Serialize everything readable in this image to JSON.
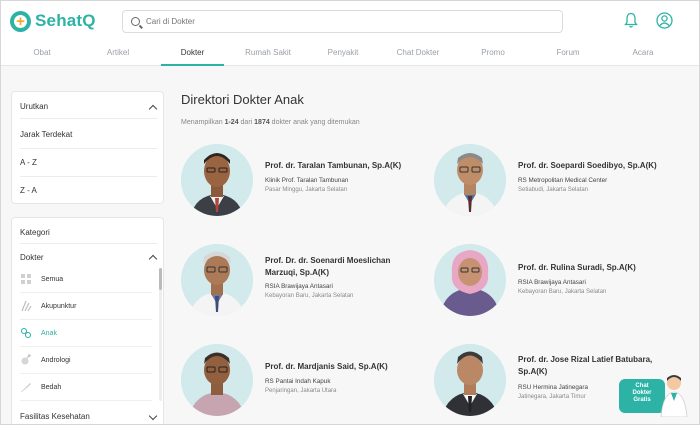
{
  "brand": {
    "name": "SehatQ",
    "accent": "#2db3a6",
    "logo_plus_color": "#f5a623"
  },
  "search": {
    "placeholder": "Cari di Dokter"
  },
  "header_icons": [
    "bell-icon",
    "user-profile-icon"
  ],
  "nav": {
    "tabs": [
      {
        "label": "Obat",
        "active": false
      },
      {
        "label": "Artikel",
        "active": false
      },
      {
        "label": "Dokter",
        "active": true
      },
      {
        "label": "Rumah Sakit",
        "active": false
      },
      {
        "label": "Penyakit",
        "active": false
      },
      {
        "label": "Chat Dokter",
        "active": false
      },
      {
        "label": "Promo",
        "active": false
      },
      {
        "label": "Forum",
        "active": false
      },
      {
        "label": "Acara",
        "active": false
      }
    ]
  },
  "sort": {
    "title": "Urutkan",
    "options": [
      "Jarak Terdekat",
      "A - Z",
      "Z - A"
    ]
  },
  "category": {
    "title": "Kategori",
    "group_label": "Dokter",
    "items": [
      {
        "label": "Semua",
        "icon": "grid-icon",
        "active": false
      },
      {
        "label": "Akupunktur",
        "icon": "acupuncture-icon",
        "active": false
      },
      {
        "label": "Anak",
        "icon": "child-icon",
        "active": true
      },
      {
        "label": "Andrologi",
        "icon": "andrology-icon",
        "active": false
      },
      {
        "label": "Bedah",
        "icon": "scalpel-icon",
        "active": false
      }
    ],
    "facility_label": "Fasilitas Kesehatan"
  },
  "main": {
    "title": "Direktori Dokter Anak",
    "subtitle_prefix": "Menampilkan ",
    "range": "1-24",
    "subtitle_mid": " dari ",
    "total": "1874",
    "subtitle_suffix": " dokter anak yang ditemukan"
  },
  "doctors": [
    {
      "name": "Prof. dr. Taralan Tambunan, Sp.A(K)",
      "hospital": "Klinik Prof. Taralan Tambunan",
      "location": "Pasar Minggu, Jakarta Selatan"
    },
    {
      "name": "Prof. dr. Soepardi Soedibyo, Sp.A(K)",
      "hospital": "RS Metropolitan Medical Center",
      "location": "Setiabudi, Jakarta Selatan"
    },
    {
      "name": "Prof. Dr. dr. Soenardi Moeslichan Marzuqi, Sp.A(K)",
      "hospital": "RSIA Brawijaya Antasari",
      "location": "Kebayoran Baru, Jakarta Selatan"
    },
    {
      "name": "Prof. dr. Rulina Suradi, Sp.A(K)",
      "hospital": "RSIA Brawijaya Antasari",
      "location": "Kebayoran Baru, Jakarta Selatan"
    },
    {
      "name": "Prof. dr. Mardjanis Said, Sp.A(K)",
      "hospital": "RS Pantai Indah Kapuk",
      "location": "Penjaringan, Jakarta Utara"
    },
    {
      "name": "Prof. dr. Jose Rizal Latief Batubara, Sp.A(K)",
      "hospital": "RSU Hermina Jatinegara",
      "location": "Jatinegara, Jakarta Timur"
    }
  ],
  "chat_fab": {
    "line1": "Chat",
    "line2": "Dokter",
    "line3": "Gratis"
  }
}
